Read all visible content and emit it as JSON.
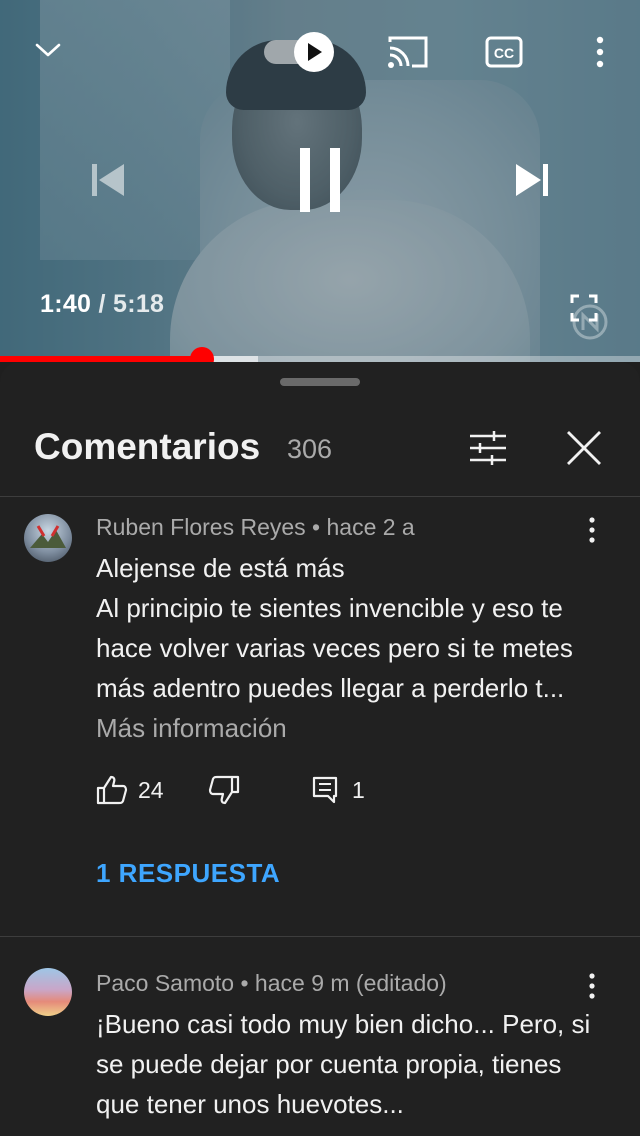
{
  "player": {
    "current_time": "1:40",
    "separator": " / ",
    "duration": "5:18",
    "progress_fraction": 0.315,
    "buffer_fraction": 0.403,
    "autoplay_on": true,
    "icons": [
      "chevron-down-icon",
      "autoplay-toggle-icon",
      "cast-icon",
      "cc-icon",
      "more-vert-icon",
      "skip-previous-icon",
      "pause-icon",
      "skip-next-icon",
      "fullscreen-icon"
    ]
  },
  "comments_panel": {
    "title": "Comentarios",
    "count": "306",
    "icons": [
      "sort-filter-icon",
      "close-icon"
    ]
  },
  "comments": [
    {
      "author": "Ruben Flores Reyes",
      "meta": " • hace 2 a",
      "text": "Alejense de está más\nAl principio te sientes invencible y eso te hace volver varias veces pero si te metes más adentro puedes llegar a perderlo t...",
      "read_more": "Más información",
      "likes": "24",
      "reply_count": "1",
      "replies_link": "1 RESPUESTA"
    },
    {
      "author": "Paco Samoto",
      "meta": " • hace 9 m (editado)",
      "text": "¡Bueno casi todo muy bien dicho... Pero, si se puede dejar por cuenta propia, tienes que tener unos huevotes..."
    }
  ],
  "colors": {
    "accent_red": "#ff0000",
    "link_blue": "#3ea6ff",
    "sheet_bg": "#212121"
  }
}
